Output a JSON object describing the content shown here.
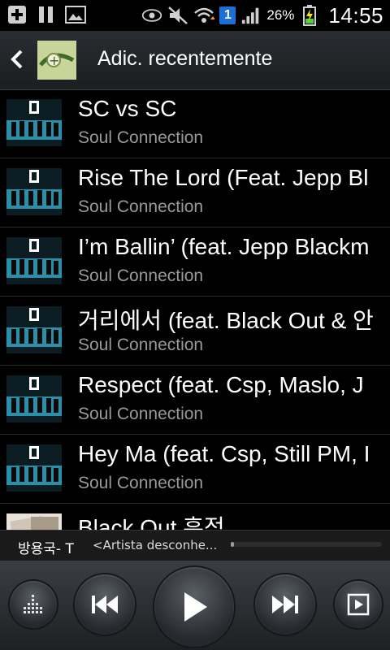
{
  "status_bar": {
    "battery_pct": "26%",
    "time": "14:55",
    "notification_count": "1",
    "icons": [
      "add-icon",
      "pause-icon",
      "gallery-icon",
      "eye-icon",
      "mute-icon",
      "wifi-icon",
      "signal-icon",
      "battery-charging-icon"
    ]
  },
  "header": {
    "title": "Adic. recentemente",
    "back_icon": "back-icon"
  },
  "songs": [
    {
      "title": "SC vs SC",
      "artist": "Soul Connection"
    },
    {
      "title": "Rise The Lord (Feat. Jepp Bl",
      "artist": "Soul Connection"
    },
    {
      "title": "I’m Ballin’ (feat. Jepp Blackm",
      "artist": "Soul Connection"
    },
    {
      "title": "거리에서 (feat. Black Out & 안",
      "artist": "Soul Connection"
    },
    {
      "title": "Respect (feat. Csp, Maslo, J",
      "artist": "Soul Connection"
    },
    {
      "title": "Hey Ma (feat. Csp, Still PM, I",
      "artist": "Soul Connection"
    },
    {
      "title": "Black Out 흔적",
      "artist": ""
    }
  ],
  "now_playing": {
    "title": "방용국- T",
    "artist": "<Artista desconhe...",
    "progress": 0.02
  },
  "controls": {
    "icons": [
      "equalizer-icon",
      "previous-icon",
      "play-icon",
      "next-icon",
      "playlist-play-icon"
    ]
  },
  "colors": {
    "accent_blue": "#1d6fd6",
    "battery_green": "#4cd137"
  }
}
